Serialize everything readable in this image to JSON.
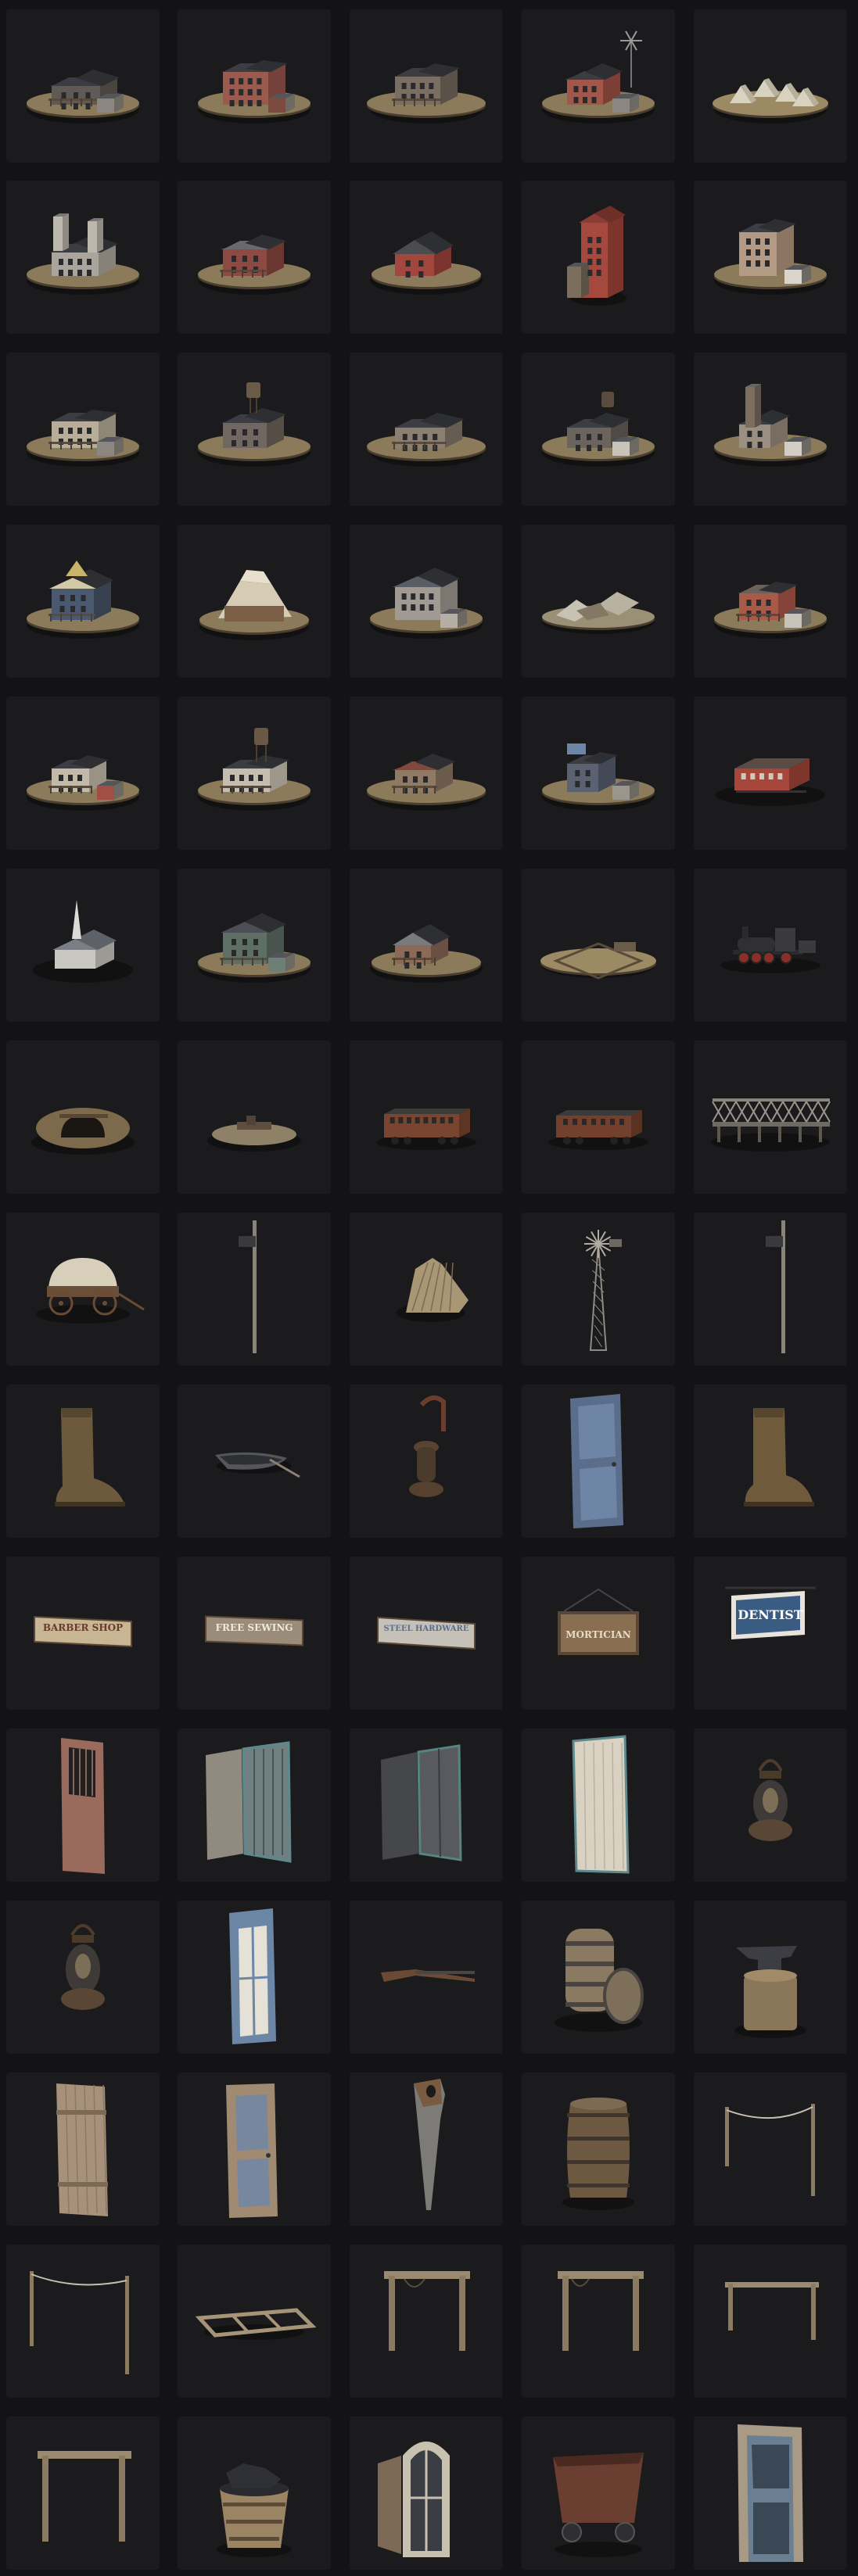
{
  "colors": {
    "page_bg": "#131315",
    "tile_bg": "#1b1b1d"
  },
  "grid": {
    "columns": 5,
    "rows": 15
  },
  "assets": [
    {
      "icon": "ranch-building-icon"
    },
    {
      "icon": "brick-hotel-icon"
    },
    {
      "icon": "saloon-building-icon"
    },
    {
      "icon": "windmill-barn-icon"
    },
    {
      "icon": "tent-camp-icon"
    },
    {
      "icon": "church-building-icon"
    },
    {
      "icon": "red-house-icon"
    },
    {
      "icon": "red-barn-icon"
    },
    {
      "icon": "grain-elevator-icon"
    },
    {
      "icon": "tall-townhouse-icon"
    },
    {
      "icon": "storefront-icon"
    },
    {
      "icon": "water-tower-house-icon"
    },
    {
      "icon": "porch-house-icon"
    },
    {
      "icon": "shack-water-tank-icon"
    },
    {
      "icon": "small-shop-icon"
    },
    {
      "icon": "blue-house-icon"
    },
    {
      "icon": "canvas-tent-house-icon"
    },
    {
      "icon": "two-story-house-icon"
    },
    {
      "icon": "ruined-camp-icon"
    },
    {
      "icon": "red-storefront-icon"
    },
    {
      "icon": "general-store-icon"
    },
    {
      "icon": "water-tower-store-icon"
    },
    {
      "icon": "small-saloon-icon"
    },
    {
      "icon": "blue-sign-shop-icon"
    },
    {
      "icon": "red-train-station-icon"
    },
    {
      "icon": "chapel-icon"
    },
    {
      "icon": "green-house-icon"
    },
    {
      "icon": "ranch-shed-icon"
    },
    {
      "icon": "corral-icon"
    },
    {
      "icon": "steam-locomotive-icon"
    },
    {
      "icon": "mine-entrance-icon"
    },
    {
      "icon": "wreck-mound-icon"
    },
    {
      "icon": "passenger-car-icon"
    },
    {
      "icon": "freight-car-icon"
    },
    {
      "icon": "truss-bridge-icon"
    },
    {
      "icon": "covered-wagon-icon"
    },
    {
      "icon": "telegraph-pole-icon"
    },
    {
      "icon": "fence-planks-icon"
    },
    {
      "icon": "windmill-icon"
    },
    {
      "icon": "street-lamp-pole-icon"
    },
    {
      "icon": "boot-icon"
    },
    {
      "icon": "rowboat-icon"
    },
    {
      "icon": "hanging-lantern-icon"
    },
    {
      "icon": "blue-door-icon"
    },
    {
      "icon": "boot-icon-2"
    },
    {
      "icon": "sign-icon",
      "sign": "BARBER SHOP"
    },
    {
      "icon": "sign-icon",
      "sign": "FREE SEWING"
    },
    {
      "icon": "sign-icon",
      "sign": "STEEL HARDWARE"
    },
    {
      "icon": "sign-icon",
      "sign": "MORTICIAN"
    },
    {
      "icon": "sign-icon",
      "sign": "DENTIST"
    },
    {
      "icon": "barred-door-icon"
    },
    {
      "icon": "wooden-shutters-icon"
    },
    {
      "icon": "dark-shutters-icon"
    },
    {
      "icon": "white-cabinet-door-icon"
    },
    {
      "icon": "oil-lantern-icon"
    },
    {
      "icon": "oil-lantern-icon-2"
    },
    {
      "icon": "blue-window-frame-icon"
    },
    {
      "icon": "rifle-icon"
    },
    {
      "icon": "barrel-with-lid-icon"
    },
    {
      "icon": "anvil-stump-icon"
    },
    {
      "icon": "plank-door-icon"
    },
    {
      "icon": "glass-door-icon"
    },
    {
      "icon": "hand-saw-icon"
    },
    {
      "icon": "wooden-barrel-icon"
    },
    {
      "icon": "rope-fence-icon"
    },
    {
      "icon": "rope-posts-icon"
    },
    {
      "icon": "fallen-frame-icon"
    },
    {
      "icon": "hitching-post-icon"
    },
    {
      "icon": "hitching-post-icon-2"
    },
    {
      "icon": "hitching-rail-icon"
    },
    {
      "icon": "gate-frame-icon"
    },
    {
      "icon": "coal-bucket-icon"
    },
    {
      "icon": "arched-window-icon"
    },
    {
      "icon": "mine-cart-icon"
    },
    {
      "icon": "doorway-icon"
    }
  ]
}
